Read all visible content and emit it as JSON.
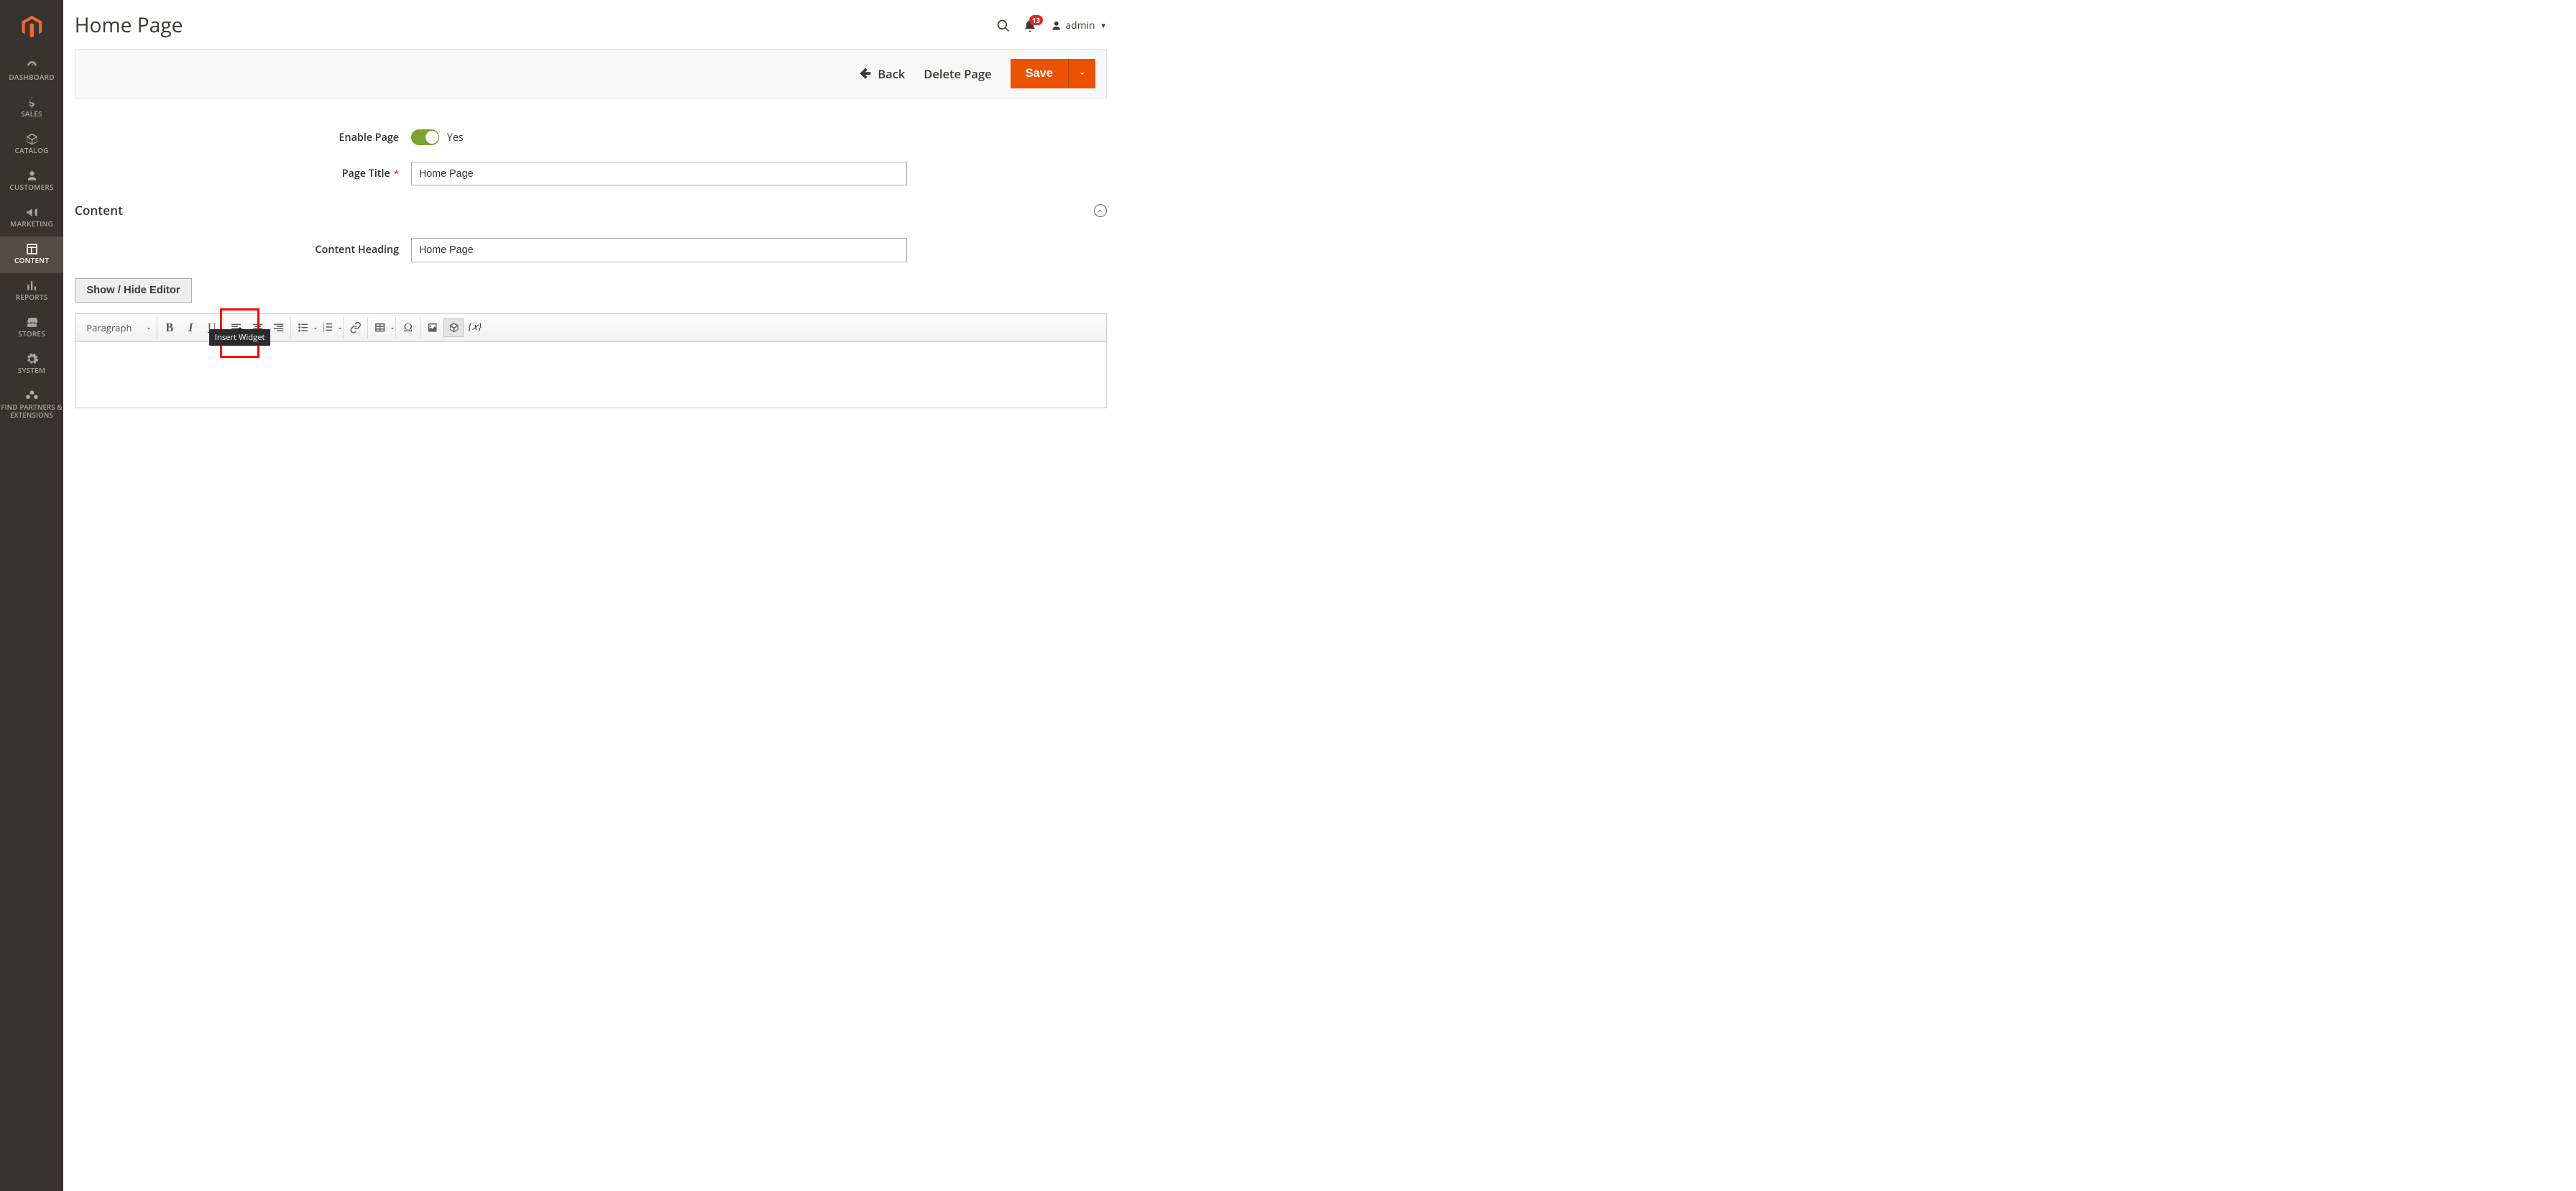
{
  "sidebar": {
    "items": [
      {
        "label": "DASHBOARD"
      },
      {
        "label": "SALES"
      },
      {
        "label": "CATALOG"
      },
      {
        "label": "CUSTOMERS"
      },
      {
        "label": "MARKETING"
      },
      {
        "label": "CONTENT"
      },
      {
        "label": "REPORTS"
      },
      {
        "label": "STORES"
      },
      {
        "label": "SYSTEM"
      },
      {
        "label": "FIND PARTNERS & EXTENSIONS"
      }
    ]
  },
  "header": {
    "page_title": "Home Page",
    "notification_count": "13",
    "user_name": "admin"
  },
  "action_bar": {
    "back_label": "Back",
    "delete_label": "Delete Page",
    "save_label": "Save"
  },
  "form": {
    "enable_page_label": "Enable Page",
    "enable_page_value": "Yes",
    "page_title_label": "Page Title",
    "page_title_value": "Home Page",
    "content_section_title": "Content",
    "content_heading_label": "Content Heading",
    "content_heading_value": "Home Page",
    "show_hide_label": "Show / Hide Editor"
  },
  "toolbar": {
    "paragraph_label": "Paragraph",
    "bold": "B",
    "italic": "I",
    "underline": "U",
    "omega": "Ω",
    "variable": "{𝑥}",
    "tooltip_insert_widget": "Insert Widget"
  }
}
